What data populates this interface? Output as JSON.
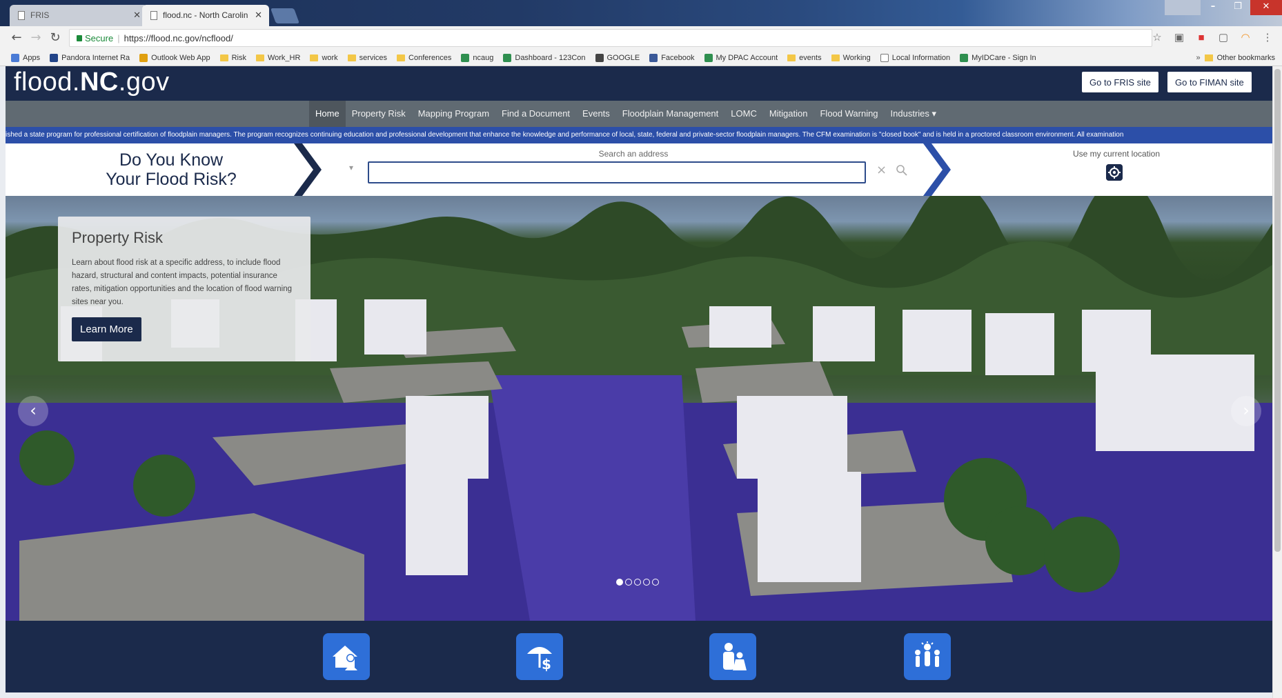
{
  "browser": {
    "tabs": [
      {
        "title": "FRIS",
        "active": false
      },
      {
        "title": "flood.nc - North Carolin",
        "active": true
      }
    ],
    "address": {
      "security_label": "Secure",
      "url": "https://flood.nc.gov/ncflood/"
    },
    "bookmarks": [
      {
        "label": "Apps",
        "icon": "apps-grid-icon"
      },
      {
        "label": "Pandora Internet Ra",
        "icon": "pandora-icon"
      },
      {
        "label": "Outlook Web App",
        "icon": "outlook-icon"
      },
      {
        "label": "Risk",
        "icon": "folder-icon"
      },
      {
        "label": "Work_HR",
        "icon": "folder-icon"
      },
      {
        "label": "work",
        "icon": "folder-icon"
      },
      {
        "label": "services",
        "icon": "folder-icon"
      },
      {
        "label": "Conferences",
        "icon": "folder-icon"
      },
      {
        "label": "ncaug",
        "icon": "bookmark-icon"
      },
      {
        "label": "Dashboard - 123Con",
        "icon": "bookmark-icon"
      },
      {
        "label": "GOOGLE",
        "icon": "google-icon"
      },
      {
        "label": "Facebook",
        "icon": "facebook-icon"
      },
      {
        "label": "My DPAC Account",
        "icon": "bookmark-icon"
      },
      {
        "label": "events",
        "icon": "folder-icon"
      },
      {
        "label": "Working",
        "icon": "folder-icon"
      },
      {
        "label": "Local Information",
        "icon": "page-icon"
      },
      {
        "label": "MyIDCare - Sign In",
        "icon": "bookmark-icon"
      }
    ],
    "other_bookmarks": "Other bookmarks"
  },
  "site": {
    "logo_prefix": "flood.",
    "logo_bold": "NC",
    "logo_suffix": ".gov",
    "header_buttons": [
      "Go to FRIS site",
      "Go to FIMAN site"
    ],
    "nav": [
      "Home",
      "Property Risk",
      "Mapping Program",
      "Find a Document",
      "Events",
      "Floodplain Management",
      "LOMC",
      "Mitigation",
      "Flood Warning",
      "Industries ▾"
    ],
    "active_nav": "Home",
    "ticker": "ished a state program for professional certification of floodplain managers. The program recognizes continuing education and professional development that enhance the knowledge and performance of local, state, federal and private-sector floodplain managers. The CFM examination is \"closed book\" and is held in a proctored classroom environment. All examination",
    "risk_question_line1": "Do You Know",
    "risk_question_line2": "Your Flood Risk?",
    "search_label": "Search an address",
    "search_value": "",
    "location_label": "Use my current location"
  },
  "hero": {
    "card_title": "Property Risk",
    "card_text": "Learn about flood risk at a specific address, to include flood hazard, structural and content impacts, potential insurance rates, mitigation opportunities and the location of flood warning sites near you.",
    "card_button": "Learn More",
    "slides": 5,
    "active_slide": 1
  },
  "features": [
    "house-family-icon",
    "umbrella-money-icon",
    "person-child-icon",
    "community-icon"
  ],
  "colors": {
    "navy": "#1b2a4b",
    "nav_gray": "#606a72",
    "ticker_blue": "#2c4fa8",
    "feature_blue": "#2e6fd8"
  }
}
